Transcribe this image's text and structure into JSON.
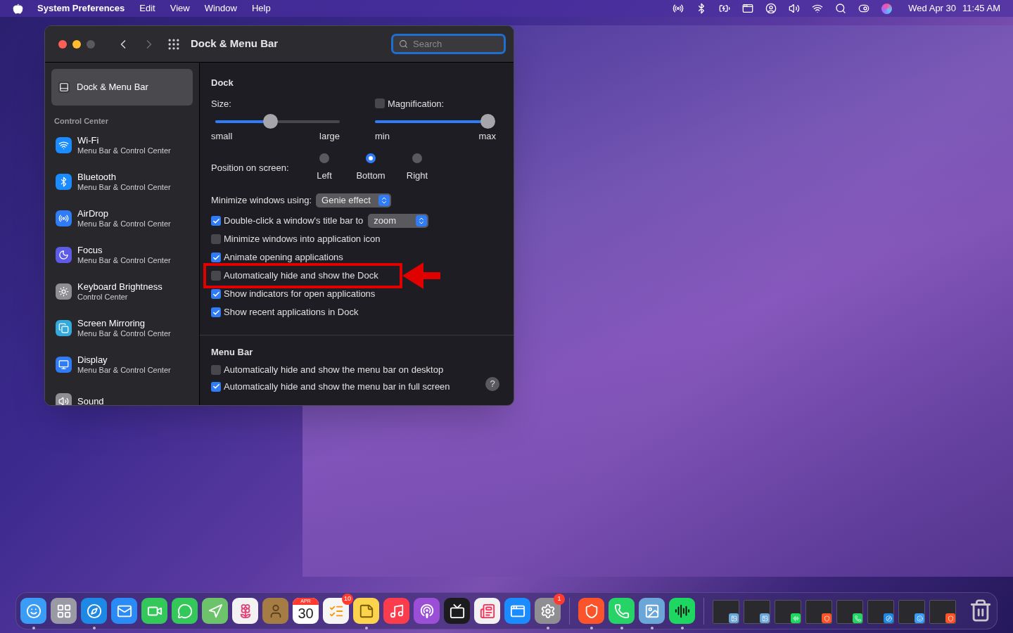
{
  "menu_bar": {
    "app_name": "System Preferences",
    "menus": [
      "Edit",
      "View",
      "Window",
      "Help"
    ],
    "status_icons": [
      {
        "kind": "airdrop"
      },
      {
        "kind": "bluetooth"
      },
      {
        "kind": "battery"
      },
      {
        "kind": "window"
      },
      {
        "kind": "user"
      },
      {
        "kind": "volume"
      },
      {
        "kind": "wifi"
      },
      {
        "kind": "search"
      },
      {
        "kind": "control"
      },
      {
        "kind": "siri"
      }
    ],
    "date": "Wed Apr 30",
    "time": "11:45 AM"
  },
  "window": {
    "title": "Dock & Menu Bar",
    "search": {
      "placeholder": "Search",
      "focused": true
    },
    "sidebar": {
      "selected_item": {
        "title": "Dock & Menu Bar",
        "selected": true
      },
      "section": "Control Center",
      "items": [
        {
          "kind": "wifi",
          "title": "Wi-Fi",
          "subtitle": "Menu Bar & Control Center"
        },
        {
          "kind": "bluetooth",
          "title": "Bluetooth",
          "subtitle": "Menu Bar & Control Center"
        },
        {
          "kind": "airdrop",
          "title": "AirDrop",
          "subtitle": "Menu Bar & Control Center"
        },
        {
          "kind": "focus",
          "title": "Focus",
          "subtitle": "Menu Bar & Control Center"
        },
        {
          "kind": "keyboard",
          "title": "Keyboard Brightness",
          "subtitle": "Control Center"
        },
        {
          "kind": "mirroring",
          "title": "Screen Mirroring",
          "subtitle": "Menu Bar & Control Center"
        },
        {
          "kind": "display",
          "title": "Display",
          "subtitle": "Menu Bar & Control Center"
        },
        {
          "kind": "sound",
          "title": "Sound"
        }
      ]
    },
    "dock": {
      "heading": "Dock",
      "size": {
        "label": "Size:",
        "level": 0.44,
        "min_label": "small",
        "max_label": "large"
      },
      "magnification": {
        "label": "Magnification:",
        "checked": false,
        "level": 1,
        "min_label": "min",
        "max_label": "max"
      },
      "position": {
        "label": "Position on screen:",
        "options": [
          {
            "label": "Left",
            "selected": false
          },
          {
            "label": "Bottom",
            "selected": true
          },
          {
            "label": "Right",
            "selected": false
          }
        ]
      },
      "minimize": {
        "label": "Minimize windows using:",
        "value": "Genie effect"
      },
      "options": [
        {
          "kind": "check_popup",
          "label": "Double-click a window's title bar to",
          "checked": true,
          "value": "zoom"
        },
        {
          "kind": "check",
          "label": "Minimize windows into application icon",
          "checked": false
        },
        {
          "kind": "check",
          "label": "Animate opening applications",
          "checked": true
        },
        {
          "kind": "check",
          "label": "Automatically hide and show the Dock",
          "checked": false,
          "highlighted": true
        },
        {
          "kind": "check",
          "label": "Show indicators for open applications",
          "checked": true
        },
        {
          "kind": "check",
          "label": "Show recent applications in Dock",
          "checked": true
        }
      ]
    },
    "menu_bar_section": {
      "heading": "Menu Bar",
      "options": [
        {
          "label": "Automatically hide and show the menu bar on desktop",
          "checked": false
        },
        {
          "label": "Automatically hide and show the menu bar in full screen",
          "checked": true
        }
      ],
      "help": "?"
    }
  },
  "dock_bar": {
    "groups": [
      [
        {
          "kind": "finder",
          "running": true
        },
        {
          "kind": "launchpad",
          "running": false
        },
        {
          "kind": "safari",
          "running": true
        },
        {
          "kind": "mail",
          "running": false
        },
        {
          "kind": "facetime",
          "running": false
        },
        {
          "kind": "messages",
          "running": false
        },
        {
          "kind": "maps",
          "running": false
        },
        {
          "kind": "photos",
          "running": false
        },
        {
          "kind": "contacts",
          "running": false
        },
        {
          "kind": "calendar",
          "running": false,
          "month": "APR",
          "day": "30"
        },
        {
          "kind": "reminders",
          "running": false,
          "badge": "10"
        },
        {
          "kind": "notes",
          "running": true
        },
        {
          "kind": "music",
          "running": false
        },
        {
          "kind": "podcasts",
          "running": false
        },
        {
          "kind": "tv",
          "running": false
        },
        {
          "kind": "news",
          "running": false
        },
        {
          "kind": "appstore",
          "running": false
        },
        {
          "kind": "settings",
          "running": true,
          "badge": "1"
        }
      ],
      [
        {
          "kind": "brave",
          "running": true
        },
        {
          "kind": "whatsapp",
          "running": true
        },
        {
          "kind": "preview",
          "running": true
        },
        {
          "kind": "spotify",
          "running": true
        }
      ]
    ],
    "minimized": [
      {
        "kind": "preview"
      },
      {
        "kind": "preview"
      },
      {
        "kind": "spotify"
      },
      {
        "kind": "brave"
      },
      {
        "kind": "whatsapp"
      },
      {
        "kind": "safari"
      },
      {
        "kind": "finder"
      },
      {
        "kind": "brave"
      }
    ]
  }
}
